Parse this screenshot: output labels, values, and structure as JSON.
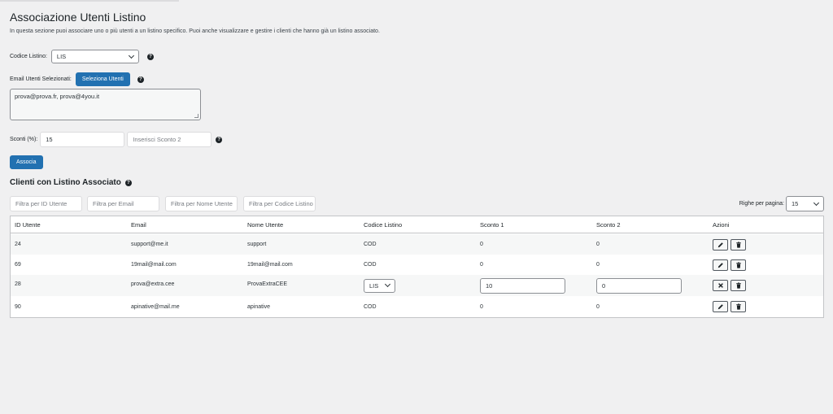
{
  "page": {
    "title": "Associazione Utenti Listino",
    "description": "In questa sezione puoi associare uno o più utenti a un listino specifico. Puoi anche visualizzare e gestire i clienti che hanno già un listino associato."
  },
  "form": {
    "codice_label": "Codice Listino:",
    "codice_value": "LIS",
    "email_label": "Email Utenti Selezionati:",
    "select_users_button": "Seleziona Utenti",
    "emails_value": "prova@prova.fr, prova@4you.it",
    "sconti_label": "Sconti (%):",
    "sconto1_value": "15",
    "sconto2_placeholder": "Inserisci Sconto 2",
    "submit_button": "Associa",
    "help_icon": "question-circle-icon"
  },
  "clients": {
    "title": "Clienti con Listino Associato",
    "filters": {
      "id_placeholder": "Filtra per ID Utente",
      "email_placeholder": "Filtra per Email",
      "nome_placeholder": "Filtra per Nome Utente",
      "codice_placeholder": "Filtra per Codice Listino"
    },
    "rows_per_page_label": "Righe per pagina:",
    "rows_per_page_value": "15",
    "columns": [
      "ID Utente",
      "Email",
      "Nome Utente",
      "Codice Listino",
      "Sconto 1",
      "Sconto 2",
      "Azioni"
    ],
    "rows": [
      {
        "id": "24",
        "email": "support@me.it",
        "nome": "support",
        "codice": "COD",
        "sconto1": "0",
        "sconto2": "0"
      },
      {
        "id": "69",
        "email": "19mail@mail.com",
        "nome": "19mail@mail.com",
        "codice": "COD",
        "sconto1": "0",
        "sconto2": "0"
      },
      {
        "id": "28",
        "email": "prova@extra.cee",
        "nome": "ProvaExtraCEE",
        "codice": "LIS",
        "sconto1": "10",
        "sconto2": "0",
        "editing": true
      },
      {
        "id": "90",
        "email": "apinative@mail.me",
        "nome": "apinative",
        "codice": "COD",
        "sconto1": "0",
        "sconto2": "0"
      }
    ],
    "icons": {
      "edit": "pencil-icon",
      "delete": "trash-icon",
      "cancel": "close-icon"
    }
  },
  "colors": {
    "primary": "#2271b1",
    "background": "#f0f0f1",
    "text": "#1d2327"
  }
}
